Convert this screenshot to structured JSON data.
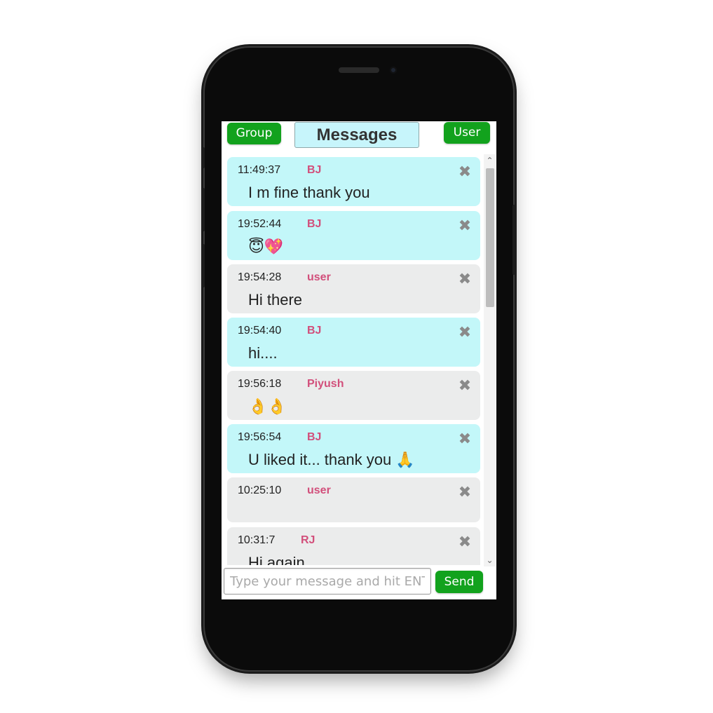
{
  "header": {
    "group_label": "Group",
    "title": "Messages",
    "user_label": "User"
  },
  "messages": [
    {
      "time": "11:49:37",
      "author": "BJ",
      "text": "I m fine thank you",
      "style": "bj"
    },
    {
      "time": "19:52:44",
      "author": "BJ",
      "text": "😇💖",
      "style": "bj"
    },
    {
      "time": "19:54:28",
      "author": "user",
      "text": "Hi there",
      "style": "other"
    },
    {
      "time": "19:54:40",
      "author": "BJ",
      "text": "hi....",
      "style": "bj"
    },
    {
      "time": "19:56:18",
      "author": "Piyush",
      "text": "👌👌",
      "style": "other"
    },
    {
      "time": "19:56:54",
      "author": "BJ",
      "text": "U liked it... thank you 🙏",
      "style": "bj"
    },
    {
      "time": "10:25:10",
      "author": "user",
      "text": "",
      "style": "other"
    },
    {
      "time": "10:31:7",
      "author": "RJ",
      "text": "Hi again",
      "style": "other"
    }
  ],
  "close_glyph": "✖",
  "composer": {
    "placeholder": "Type your message and hit ENTER",
    "send_label": "Send"
  },
  "colors": {
    "accent_green": "#12a21d",
    "bj_bubble": "#c3f7f9",
    "other_bubble": "#ebecec",
    "author_pink": "#d24f7b"
  }
}
